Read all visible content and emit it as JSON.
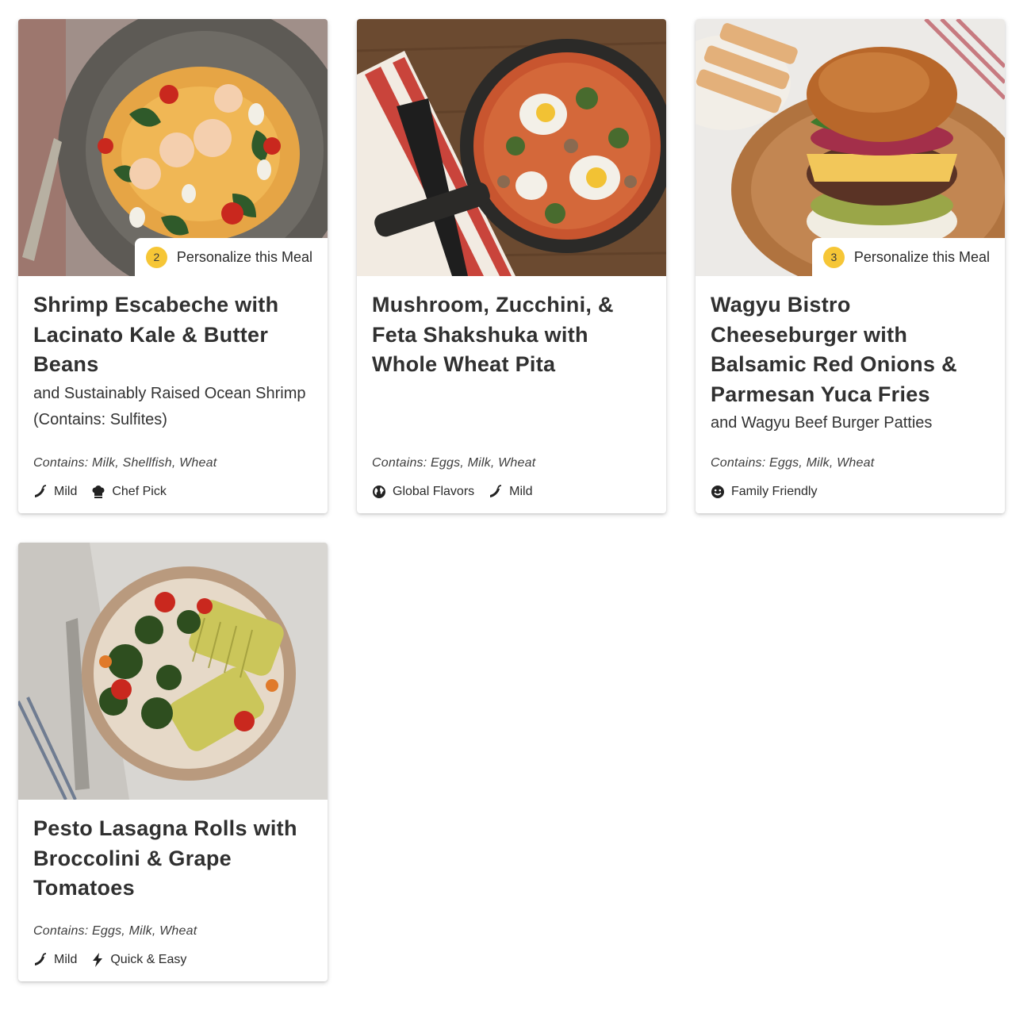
{
  "meals": [
    {
      "title": "Shrimp Escabeche with Lacinato Kale & Butter Beans",
      "subtitle": "and Sustainably Raised Ocean Shrimp (Contains: Sulfites)",
      "contains": "Contains: Milk, Shellfish, Wheat",
      "personalize": {
        "count": "2",
        "label": "Personalize this Meal"
      },
      "tags": [
        {
          "icon": "chili-pepper-icon",
          "label": "Mild"
        },
        {
          "icon": "chef-hat-icon",
          "label": "Chef Pick"
        }
      ]
    },
    {
      "title": "Mushroom, Zucchini, & Feta Shakshuka with Whole Wheat Pita",
      "subtitle": "",
      "contains": "Contains: Eggs, Milk, Wheat",
      "tags": [
        {
          "icon": "globe-icon",
          "label": "Global Flavors"
        },
        {
          "icon": "chili-pepper-icon",
          "label": "Mild"
        }
      ]
    },
    {
      "title": "Wagyu Bistro Cheeseburger with Balsamic Red Onions & Parmesan Yuca Fries",
      "subtitle": "and Wagyu Beef Burger Patties",
      "contains": "Contains: Eggs, Milk, Wheat",
      "personalize": {
        "count": "3",
        "label": "Personalize this Meal"
      },
      "tags": [
        {
          "icon": "smiley-face-icon",
          "label": "Family Friendly"
        }
      ]
    },
    {
      "title": "Pesto Lasagna Rolls with Broccolini & Grape Tomatoes",
      "subtitle": "",
      "contains": "Contains: Eggs, Milk, Wheat",
      "tags": [
        {
          "icon": "chili-pepper-icon",
          "label": "Mild"
        },
        {
          "icon": "lightning-bolt-icon",
          "label": "Quick & Easy"
        }
      ]
    }
  ],
  "colors": {
    "badge": "#f6c636",
    "text": "#2b2b2b"
  }
}
